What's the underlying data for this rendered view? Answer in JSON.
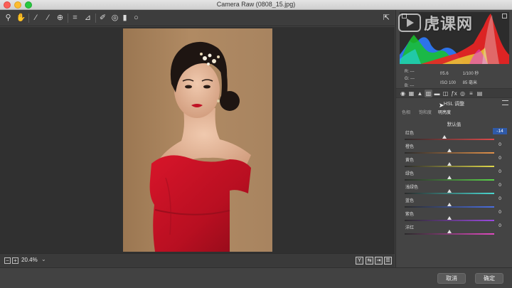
{
  "window": {
    "title": "Camera Raw (0808_15.jpg)"
  },
  "toolbar": {
    "tools": [
      "zoom-tool",
      "hand-tool",
      "white-balance-tool",
      "color-sampler-tool",
      "targeted-adjustment-tool",
      "crop-tool",
      "straighten-tool",
      "spot-removal-tool",
      "red-eye-tool",
      "adjustment-brush",
      "graduated-filter",
      "radial-filter"
    ],
    "active_tool": "targeted-adjustment-tool"
  },
  "histogram": {
    "rgb_labels": [
      "R:",
      "G:",
      "B:"
    ],
    "rgb_values": [
      "---",
      "---",
      "---"
    ]
  },
  "camera_info": {
    "aperture": "f/5.6",
    "shutter": "1/100 秒",
    "iso": "ISO 100",
    "focal": "85 毫米"
  },
  "panel": {
    "title": "HSL 调整",
    "subtabs": [
      "色相",
      "饱和度",
      "明亮度"
    ],
    "active_subtab": 2,
    "default_label": "默认值",
    "sliders": [
      {
        "label": "红色",
        "value": "-14",
        "position": 0.445,
        "selected": true,
        "gradient": [
          "#2b2b2b",
          "#e04a4a"
        ]
      },
      {
        "label": "橙色",
        "value": "0",
        "position": 0.5,
        "selected": false,
        "gradient": [
          "#2b2b2b",
          "#e0914a"
        ]
      },
      {
        "label": "黄色",
        "value": "0",
        "position": 0.5,
        "selected": false,
        "gradient": [
          "#2b2b2b",
          "#e0d84a"
        ]
      },
      {
        "label": "绿色",
        "value": "0",
        "position": 0.5,
        "selected": false,
        "gradient": [
          "#2b2b2b",
          "#5bd24a"
        ]
      },
      {
        "label": "浅绿色",
        "value": "0",
        "position": 0.5,
        "selected": false,
        "gradient": [
          "#2b2b2b",
          "#4ad6cf"
        ]
      },
      {
        "label": "蓝色",
        "value": "0",
        "position": 0.5,
        "selected": false,
        "gradient": [
          "#2b2b2b",
          "#4a6ee0"
        ]
      },
      {
        "label": "紫色",
        "value": "0",
        "position": 0.5,
        "selected": false,
        "gradient": [
          "#2b2b2b",
          "#9b4ae0"
        ]
      },
      {
        "label": "洋红",
        "value": "0",
        "position": 0.5,
        "selected": false,
        "gradient": [
          "#2b2b2b",
          "#e04ac0"
        ]
      }
    ]
  },
  "status": {
    "zoom": "20.4%"
  },
  "footer": {
    "cancel": "取消",
    "ok": "确定"
  },
  "watermark": {
    "text": "虎课网"
  }
}
